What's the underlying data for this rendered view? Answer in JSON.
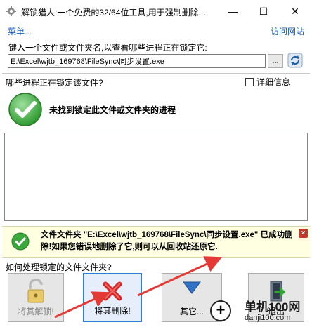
{
  "window": {
    "title": "解锁猎人:一个免费的32/64位工具,用于强制删除...",
    "min_symbol": "—",
    "max_symbol": "☐",
    "close_symbol": "✕"
  },
  "menu": {
    "left": "菜单...",
    "right": "访问网站"
  },
  "input": {
    "prompt": "键入一个文件或文件夹名,以查看哪些进程正在锁定它:",
    "value": "E:\\Excel\\wjtb_169768\\FileSync\\同步设置.exe",
    "browse_label": "..."
  },
  "locking": {
    "question": "哪些进程正在锁定该文件?",
    "detail_label": "详细信息",
    "result_text": "未找到锁定此文件或文件夹的进程"
  },
  "notice": {
    "text": "文件文件夹 \"E:\\Excel\\wjtb_169768\\FileSync\\同步设置.exe\" 已成功删除!如果您错误地删除了它,则可以从回收站还原它."
  },
  "actions": {
    "how_label": "如何处理锁定的文件文件夹?",
    "unlock": "将其解锁!",
    "delete": "将其删除!",
    "other": "其它...",
    "exit": "退出"
  },
  "watermark": {
    "name": "单机100网",
    "url": "danji100.com",
    "badge": "+"
  },
  "colors": {
    "link": "#1a5fb4",
    "notice_bg": "#ffffe1",
    "check_green": "#3aa83a",
    "delete_x": "#d62828",
    "arrow_red": "#e53935",
    "selected_border": "#2a7fd6"
  }
}
